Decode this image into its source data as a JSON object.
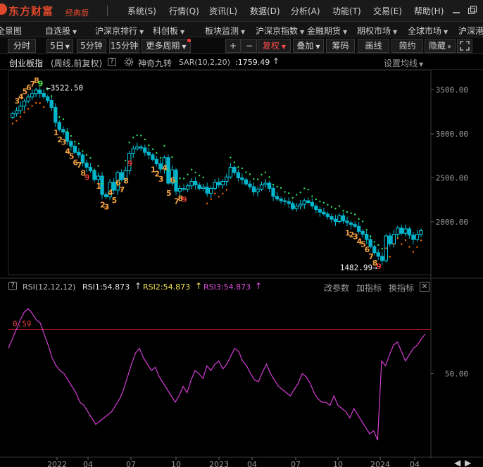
{
  "app": {
    "brand": "东方财富",
    "edition": "经典版"
  },
  "menu": [
    "系统(S)",
    "行情(Q)",
    "资讯(L)",
    "数据(D)",
    "分析(A)",
    "功能(T)",
    "交易(E)",
    "帮助(H)"
  ],
  "nav": [
    {
      "label": "全景图",
      "dropdown": false
    },
    {
      "label": "自选股",
      "dropdown": true
    },
    {
      "label": "沪深京排行",
      "dropdown": true
    },
    {
      "label": "科创板",
      "dropdown": true
    },
    {
      "label": "板块监测",
      "dropdown": true
    },
    {
      "label": "沪深京指数",
      "dropdown": true
    },
    {
      "label": "金融期货",
      "dropdown": true
    },
    {
      "label": "期权市场",
      "dropdown": true
    },
    {
      "label": "全球市场",
      "dropdown": true
    },
    {
      "label": "沪深港",
      "dropdown": false
    }
  ],
  "toolbar": {
    "periods": [
      "分时",
      "5日",
      "5分钟",
      "15分钟",
      "更多周期"
    ],
    "adjust": "复权",
    "overlay": "叠加",
    "chips": "筹码",
    "draw": "画线",
    "simple": "简约",
    "hide": "隐藏"
  },
  "info": {
    "name": "创业板指",
    "mode": "(周线,前复权)",
    "indicator": "神奇九转",
    "sar": "SAR(10,2,20)",
    "sar_value": ":1759.49",
    "ma_settings": "设置均线"
  },
  "rsi": {
    "name": "RSI(12,12,12)",
    "rsi1": "RSI1:54.873",
    "rsi2": "RSI2:54.873",
    "rsi3": "RSI3:54.873",
    "edit_params": "改参数",
    "add_indicator": "加指标",
    "switch_indicator": "换指标"
  },
  "colors": {
    "up": "#00d0e8",
    "down": "#00b4cc",
    "sar": "#ff6a00",
    "sar_bear": "#33dd66",
    "rsi": "#d23ed2",
    "rsi_line": "#c81e1e"
  },
  "chart_data": {
    "type": "candlestick",
    "series_label": "创业板指",
    "period": "weekly",
    "y_ticks": [
      "3500.00",
      "3000.00",
      "2500.00",
      "2000.00"
    ],
    "ylim": [
      1400,
      3720
    ],
    "high_label": "3522.50",
    "low_label": "1482.99",
    "x_ticks": [
      "2022",
      "04",
      "07",
      "10",
      "2023",
      "04",
      "07",
      "10",
      "2024",
      "04"
    ],
    "close": [
      3228,
      3264,
      3314,
      3372,
      3418,
      3458,
      3497,
      3460,
      3420,
      3380,
      3300,
      3130,
      3050,
      3020,
      2915,
      2860,
      2790,
      2760,
      2670,
      2620,
      2580,
      2480,
      2520,
      2310,
      2285,
      2450,
      2360,
      2560,
      2480,
      2580,
      2780,
      2830,
      2850,
      2840,
      2790,
      2760,
      2710,
      2660,
      2600,
      2730,
      2440,
      2590,
      2350,
      2380,
      2370,
      2410,
      2460,
      2420,
      2380,
      2395,
      2325,
      2380,
      2450,
      2420,
      2460,
      2510,
      2620,
      2560,
      2500,
      2480,
      2430,
      2400,
      2340,
      2372,
      2420,
      2440,
      2380,
      2290,
      2260,
      2240,
      2230,
      2210,
      2150,
      2180,
      2200,
      2240,
      2220,
      2180,
      2140,
      2110,
      2090,
      2060,
      2030,
      2004,
      2070,
      2010,
      1990,
      1970,
      1950,
      1893,
      1860,
      1800,
      1720,
      1650,
      1609,
      1560,
      1840,
      1750,
      1860,
      1930,
      1870,
      1920,
      1850,
      1800,
      1860,
      1900
    ],
    "td_setup_labels": [
      {
        "text": "3"
      },
      {
        "text": "4"
      },
      {
        "text": "5"
      },
      {
        "text": "6"
      },
      {
        "text": "7"
      },
      {
        "text": "8"
      },
      {
        "text": "9"
      },
      {
        "text": "1"
      },
      {
        "text": "2"
      },
      {
        "text": "3"
      },
      {
        "text": "4"
      },
      {
        "text": "5"
      },
      {
        "text": "6"
      },
      {
        "text": "7"
      },
      {
        "text": "8"
      },
      {
        "text": "9"
      },
      {
        "text": "1"
      },
      {
        "text": "2"
      },
      {
        "text": "3"
      },
      {
        "text": "4"
      },
      {
        "text": "5"
      },
      {
        "text": "6"
      },
      {
        "text": "7"
      },
      {
        "text": "8"
      },
      {
        "text": "9"
      },
      {
        "text": "1"
      },
      {
        "text": "2"
      },
      {
        "text": "3"
      },
      {
        "text": "4"
      },
      {
        "text": "5"
      },
      {
        "text": "6"
      },
      {
        "text": "7"
      },
      {
        "text": "8"
      },
      {
        "text": "9"
      },
      {
        "text": "1"
      },
      {
        "text": "2"
      },
      {
        "text": "3"
      },
      {
        "text": "4"
      },
      {
        "text": "5"
      },
      {
        "text": "6"
      },
      {
        "text": "7"
      },
      {
        "text": "8"
      },
      {
        "text": "9"
      }
    ],
    "rsi3": [
      66,
      72,
      78,
      84,
      89,
      91,
      88,
      84,
      82,
      75,
      68,
      60,
      55,
      52,
      50,
      46,
      42,
      38,
      32,
      30,
      26,
      22,
      18,
      20,
      22,
      24,
      26,
      30,
      34,
      40,
      48,
      56,
      63,
      66,
      60,
      56,
      52,
      54,
      48,
      44,
      40,
      36,
      32,
      36,
      42,
      38,
      46,
      52,
      50,
      47,
      55,
      52,
      56,
      58,
      53,
      56,
      61,
      66,
      64,
      58,
      55,
      50,
      46,
      45,
      51,
      56,
      50,
      46,
      42,
      40,
      38,
      36,
      40,
      44,
      50,
      48,
      44,
      38,
      34,
      32,
      32,
      30,
      36,
      30,
      28,
      26,
      22,
      28,
      24,
      20,
      16,
      12,
      14,
      8,
      58,
      55,
      62,
      68,
      70,
      64,
      58,
      62,
      66,
      68,
      72,
      75
    ],
    "rsi_ref_label": "0.59",
    "rsi_tick": "50.00"
  }
}
